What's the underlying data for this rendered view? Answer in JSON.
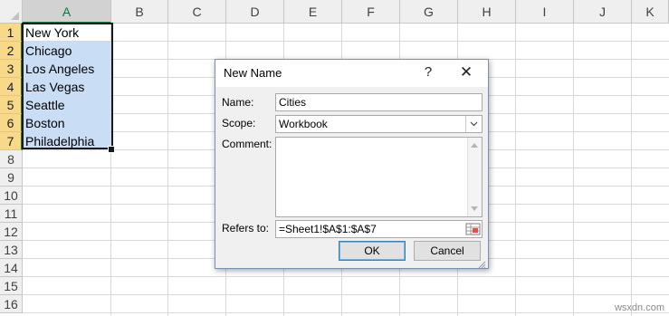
{
  "sheet": {
    "columns": [
      "A",
      "B",
      "C",
      "D",
      "E",
      "F",
      "G",
      "H",
      "I",
      "J",
      "K"
    ],
    "rows": [
      "1",
      "2",
      "3",
      "4",
      "5",
      "6",
      "7",
      "8",
      "9",
      "10",
      "11",
      "12",
      "13",
      "14",
      "15",
      "16"
    ],
    "cells": [
      "New York",
      "Chicago",
      "Los Angeles",
      "Las Vegas",
      "Seattle",
      "Boston",
      "Philadelphia"
    ],
    "selection_color": "#c9def5",
    "accent_color": "#217346"
  },
  "dialog": {
    "title": "New Name",
    "help_glyph": "?",
    "close_glyph": "✕",
    "name_label": "Name:",
    "name_value": "Cities",
    "scope_label": "Scope:",
    "scope_value": "Workbook",
    "comment_label": "Comment:",
    "comment_value": "",
    "refers_label": "Refers to:",
    "refers_value": "=Sheet1!$A$1:$A$7",
    "ok_label": "OK",
    "cancel_label": "Cancel"
  },
  "icons": {
    "combo_arrow": "chevron-down-icon",
    "range_picker": "collapse-dialog-icon",
    "resize": "resize-grip-icon"
  },
  "watermark": "wsxdn.com"
}
